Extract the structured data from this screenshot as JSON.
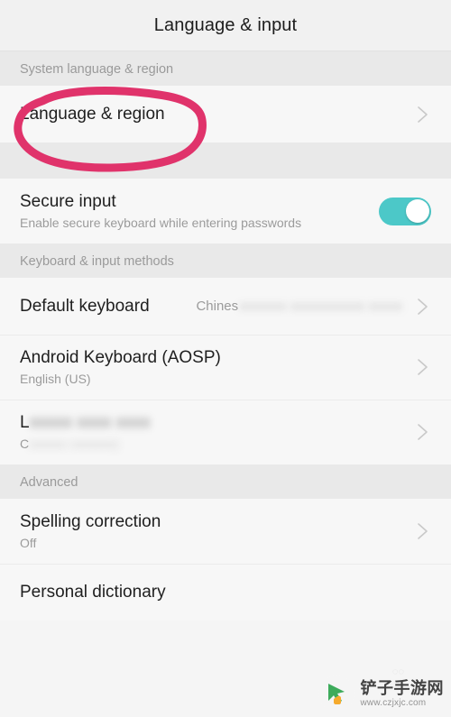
{
  "appbar": {
    "title": "Language & input"
  },
  "colors": {
    "annotation_pink": "#e0336b",
    "toggle_on_teal": "#4cc8c8",
    "page_background": "#f5f5f5",
    "row_background": "#f7f7f7",
    "section_band": "#e9e9e9",
    "title_text": "#1f1f1f",
    "muted_text": "#9b9b9b"
  },
  "sections": [
    {
      "header": "System language & region",
      "rows": [
        {
          "title": "Language & region",
          "subtitle": "",
          "value": "",
          "accessory": "chevron-right-icon",
          "annotated": true
        }
      ]
    },
    {
      "header": "",
      "rows": [
        {
          "title": "Secure input",
          "subtitle": "Enable secure keyboard while entering passwords",
          "value": "",
          "accessory": "toggle-switch",
          "toggle_state": "on"
        }
      ]
    },
    {
      "header": "Keyboard & input methods",
      "rows": [
        {
          "title": "Default keyboard",
          "subtitle": "",
          "value_visible": "Chines",
          "value_redacted": "xxxxxxx xxxxxxxxxxx xxxxx",
          "accessory": "chevron-right-icon"
        },
        {
          "title": "Android Keyboard (AOSP)",
          "subtitle": "English (US)",
          "value": "",
          "accessory": "chevron-right-icon"
        },
        {
          "title_visible": "L",
          "title_redacted": "xxxxx xxxx xxxx",
          "subtitle_visible": "C",
          "subtitle_redacted": "xxxxxx xxxxxxx)",
          "accessory": "chevron-right-icon",
          "redacted": true
        }
      ]
    },
    {
      "header": "Advanced",
      "rows": [
        {
          "title": "Spelling correction",
          "subtitle": "Off",
          "value": "",
          "accessory": "chevron-right-icon"
        },
        {
          "title": "Personal dictionary",
          "subtitle": "",
          "value": "",
          "accessory": ""
        }
      ]
    }
  ],
  "watermark": {
    "name": "铲子手游网",
    "url": "www.czjxjc.com"
  }
}
